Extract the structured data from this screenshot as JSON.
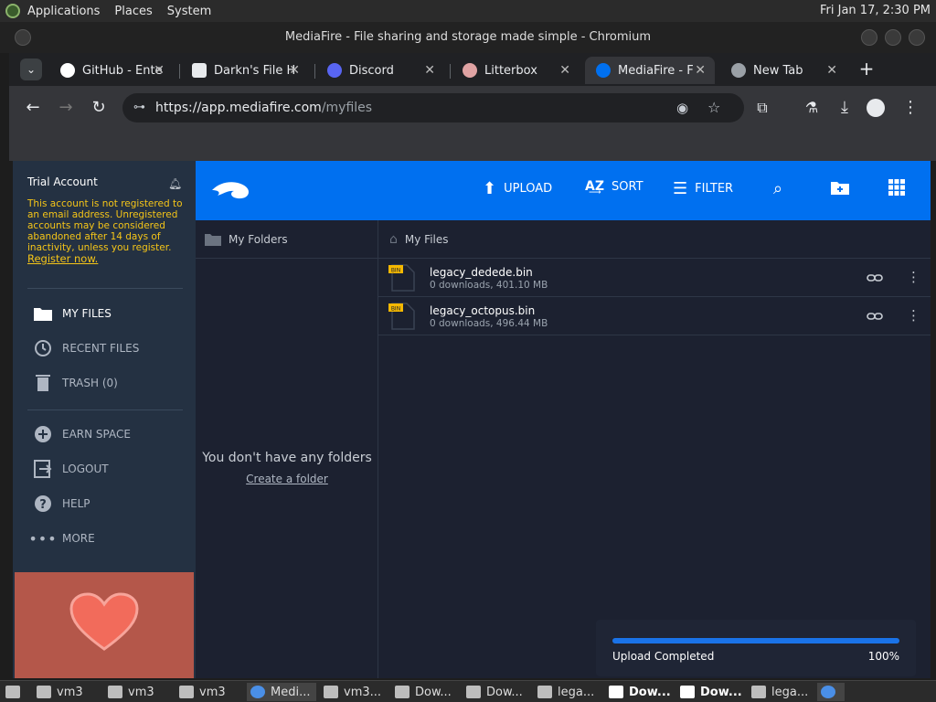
{
  "top_panel": {
    "menus": [
      "Applications",
      "Places",
      "System"
    ],
    "clock": "Fri Jan 17,  2:30 PM"
  },
  "window": {
    "title": "MediaFire - File sharing and storage made simple - Chromium"
  },
  "tabs": [
    {
      "label": "GitHub - Ente",
      "icon": "github-icon"
    },
    {
      "label": "Darkn's File H",
      "icon": "download-box-icon"
    },
    {
      "label": "Discord",
      "icon": "discord-icon"
    },
    {
      "label": "Litterbox",
      "icon": "litterbox-icon"
    },
    {
      "label": "MediaFire - F",
      "icon": "mediafire-icon",
      "active": true
    },
    {
      "label": "New Tab",
      "icon": "globe-icon"
    }
  ],
  "address_bar": {
    "host": "https://app.mediafire.com",
    "path": "/myfiles"
  },
  "sidebar": {
    "account": "Trial Account",
    "warning": "This account is not registered to an email address. Unregistered accounts may be considered abandoned after 14 days of inactivity, unless you register.",
    "register_link": "Register now.",
    "nav": [
      {
        "label": "MY FILES",
        "icon": "folder-icon",
        "active": true
      },
      {
        "label": "RECENT FILES",
        "icon": "clock-icon"
      },
      {
        "label": "TRASH (0)",
        "icon": "trash-icon"
      }
    ],
    "nav2": [
      {
        "label": "EARN SPACE",
        "icon": "plus-circle-icon"
      },
      {
        "label": "LOGOUT",
        "icon": "logout-icon"
      },
      {
        "label": "HELP",
        "icon": "help-icon"
      },
      {
        "label": "MORE",
        "icon": "more-dots-icon"
      }
    ]
  },
  "header": {
    "upload": "UPLOAD",
    "sort": "SORT",
    "filter": "FILTER"
  },
  "folders_panel": {
    "title": "My Folders",
    "empty": "You don't have any folders",
    "create": "Create a folder"
  },
  "files_panel": {
    "title": "My Files",
    "files": [
      {
        "name": "legacy_dedede.bin",
        "meta": "0 downloads, 401.10 MB",
        "badge": "BIN"
      },
      {
        "name": "legacy_octopus.bin",
        "meta": "0 downloads, 496.44 MB",
        "badge": "BIN"
      }
    ]
  },
  "upload_status": {
    "label": "Upload Completed",
    "percent_text": "100%",
    "progress": 1.0
  },
  "taskbar": [
    {
      "label": "vm3"
    },
    {
      "label": "vm3"
    },
    {
      "label": "vm3"
    },
    {
      "label": "Medi...",
      "active": true
    },
    {
      "label": "vm3..."
    },
    {
      "label": "Dow..."
    },
    {
      "label": "Dow..."
    },
    {
      "label": "lega..."
    },
    {
      "label": "Dow...",
      "bold": true
    },
    {
      "label": "Dow...",
      "bold": true
    },
    {
      "label": "lega..."
    }
  ],
  "colors": {
    "accent_blue": "#0070f0",
    "sidebar_bg": "#243142",
    "warning": "#f5c518",
    "badge": "#f5b800"
  }
}
